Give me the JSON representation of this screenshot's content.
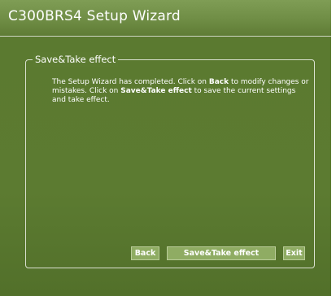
{
  "window": {
    "title": "C300BRS4 Setup Wizard"
  },
  "section": {
    "legend": "Save&Take effect",
    "message": {
      "part1": "The Setup Wizard has completed. Click on ",
      "back_ref": "Back",
      "part2": " to modify changes or mistakes. Click on ",
      "save_ref": "Save&Take effect",
      "part3": " to save the current settings and take effect."
    }
  },
  "buttons": {
    "back": "Back",
    "save": "Save&Take effect",
    "exit": "Exit"
  },
  "colors": {
    "panel_green": "#5c7b31",
    "titlebar_green": "#7a9850",
    "button_green": "#8fac63",
    "text": "#ffffff"
  }
}
